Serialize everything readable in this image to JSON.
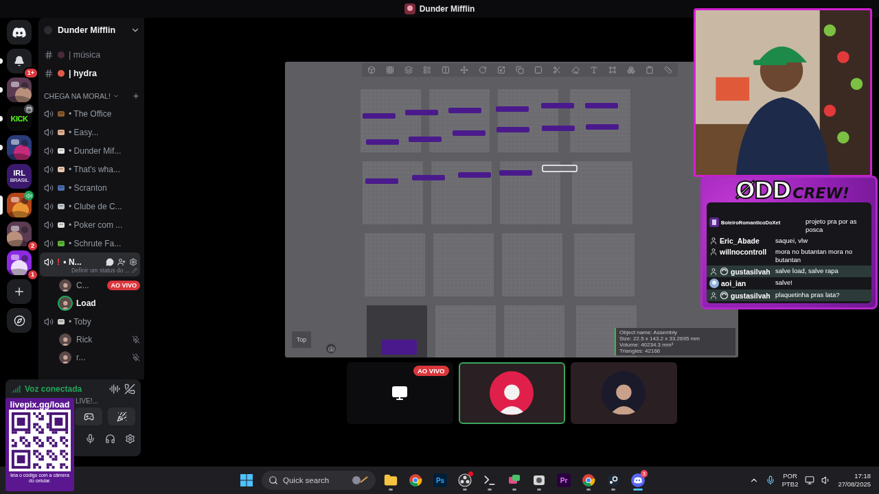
{
  "window": {
    "title": "Dunder Mifflin"
  },
  "server_rail": [
    {
      "kind": "home",
      "selected": false,
      "unread": false
    },
    {
      "kind": "notifications",
      "badge": "1+",
      "selected": false,
      "unread": true
    },
    {
      "kind": "picture",
      "selected": false,
      "unread": true
    },
    {
      "kind": "label",
      "label": "KICK",
      "event": true,
      "selected": false,
      "unread": true
    },
    {
      "kind": "picture",
      "selected": false,
      "unread": true
    },
    {
      "kind": "label",
      "label": "IRL",
      "sublabel": "BRASIL",
      "selected": false,
      "unread": false
    },
    {
      "kind": "picture",
      "voice_active": true,
      "selected": true,
      "unread": false
    },
    {
      "kind": "picture",
      "badge": "2",
      "selected": false,
      "unread": false
    },
    {
      "kind": "picture",
      "badge": "1",
      "selected": false,
      "unread": false
    },
    {
      "kind": "add",
      "selected": false,
      "unread": false
    },
    {
      "kind": "discover",
      "selected": false,
      "unread": false
    }
  ],
  "channel_header": {
    "title": "Dunder Mifflin"
  },
  "text_channels": [
    {
      "name": "| música",
      "unread": false
    },
    {
      "name": "| hydra",
      "unread": true
    }
  ],
  "category": {
    "name": "CHEGA NA MORAL!"
  },
  "voice_channels": [
    {
      "name": "• The Office",
      "selected": false
    },
    {
      "name": "• Easy...",
      "selected": false
    },
    {
      "name": "• Dunder Mif...",
      "selected": false
    },
    {
      "name": "• That's wha...",
      "selected": false
    },
    {
      "name": "• Scranton",
      "selected": false
    },
    {
      "name": "• Clube de C...",
      "selected": false
    },
    {
      "name": "• Poker com ...",
      "selected": false
    },
    {
      "name": "• Schrute Fa...",
      "selected": false
    },
    {
      "name": "• N...",
      "alert": "!",
      "status": "Definir um status do ...",
      "selected": true,
      "members": [
        {
          "name": "C...",
          "live": "AO VIVO",
          "speaking": false,
          "muted": false
        },
        {
          "name": "Load",
          "speaking": true,
          "muted": false
        }
      ]
    },
    {
      "name": "• Toby",
      "selected": false,
      "members": [
        {
          "name": "Rick",
          "speaking": false,
          "muted": true
        },
        {
          "name": "r...",
          "speaking": false,
          "muted": true
        }
      ]
    }
  ],
  "voice": {
    "status": "Voz conectada",
    "channel": "LIVE!..."
  },
  "donation": {
    "url": "livepix.gg/load",
    "caption": "leia o código com a câmera do celular."
  },
  "screen_share": {
    "view_label": "Top",
    "info": [
      "Object name: Assembly",
      "Size: 22.5 x 143.2 x 33.2695 mm",
      "Volume: 40234.3 mm³",
      "Triangles: 42166"
    ]
  },
  "participants": [
    {
      "kind": "screen",
      "live": "AO VIVO",
      "speaking": false
    },
    {
      "kind": "avatar",
      "speaking": true
    },
    {
      "kind": "avatar",
      "speaking": false
    }
  ],
  "webcam": {
    "kind": "picture"
  },
  "chat": {
    "logo_main": "ØDD",
    "logo_accent": "CREW!",
    "messages": [
      {
        "user": "BoleiroRomanticoDoXet",
        "text": "projeto pra por as posca",
        "kind": "badge",
        "highlighted": false
      },
      {
        "user": "Eric_Abade",
        "text": "saquei, vlw",
        "kind": "person",
        "highlighted": false
      },
      {
        "user": "willnocontroll",
        "text": "mora no butantan mora no butantan",
        "kind": "person",
        "highlighted": false
      },
      {
        "user": "gustasilvah",
        "text": "salve load, salve rapa",
        "kind": "person_ring",
        "highlighted": true
      },
      {
        "user": "aoi_ian",
        "text": "salve!",
        "highlighted": false
      },
      {
        "user": "gustasilvah",
        "text": "plaquetinha pras lata?",
        "kind": "person_ring",
        "highlighted": true
      }
    ]
  },
  "taskbar": {
    "search": {
      "placeholder": "Quick search"
    },
    "apps": [
      {
        "kind": "folder",
        "running": true,
        "active": false
      },
      {
        "kind": "chrome",
        "running": false,
        "active": false
      },
      {
        "kind": "label",
        "label": "Ps",
        "running": false,
        "active": false
      },
      {
        "kind": "obs",
        "alert": true,
        "running": true,
        "active": false
      },
      {
        "kind": "terminal",
        "running": true,
        "active": false
      },
      {
        "kind": "chat",
        "running": true,
        "active": false
      },
      {
        "kind": "drive",
        "running": true,
        "active": false
      },
      {
        "kind": "label",
        "label": "Pr",
        "running": false,
        "active": false
      },
      {
        "kind": "chrome",
        "running": true,
        "active": false
      },
      {
        "kind": "steam",
        "running": true,
        "active": false
      },
      {
        "kind": "discord",
        "badge": "3",
        "running": true,
        "active": true
      }
    ],
    "tray": {
      "language": "POR",
      "layout": "PTB2",
      "time": "17:18",
      "date": "27/08/2025"
    }
  }
}
